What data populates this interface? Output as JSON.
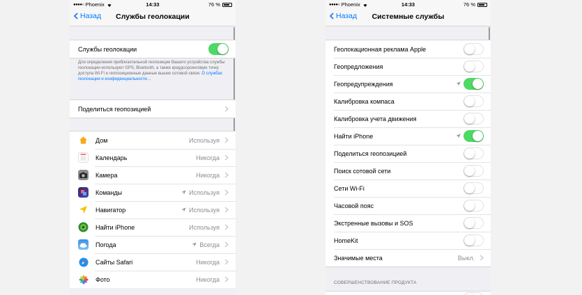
{
  "colors": {
    "accent": "#007aff",
    "toggle_on": "#4cd964",
    "secondary_text": "#8e8e93"
  },
  "left": {
    "status": {
      "carrier": "Phoenix",
      "time": "14:33",
      "battery": "76 %"
    },
    "nav": {
      "back": "Назад",
      "title": "Службы геолокации"
    },
    "main_toggle": {
      "label": "Службы геолокации",
      "on": true
    },
    "footer": {
      "text": "Для определения приблизительной геопозиции Вашего устройства службы геолокации используют GPS, Bluetooth, а также краудсорсинговую точку доступа Wi-Fi и геопозиционные данные вышек сотовой связи.",
      "link": "О службах геолокации и конфиденциальности…"
    },
    "share": {
      "label": "Поделиться геопозицией"
    },
    "apps": [
      {
        "name": "Дом",
        "value": "Используя",
        "arrow": false,
        "icon": "home-app-icon"
      },
      {
        "name": "Календарь",
        "value": "Никогда",
        "arrow": false,
        "icon": "calendar-app-icon"
      },
      {
        "name": "Камера",
        "value": "Никогда",
        "arrow": false,
        "icon": "camera-app-icon"
      },
      {
        "name": "Команды",
        "value": "Используя",
        "arrow": true,
        "icon": "shortcuts-app-icon"
      },
      {
        "name": "Навигатор",
        "value": "Используя",
        "arrow": true,
        "icon": "navigator-app-icon"
      },
      {
        "name": "Найти iPhone",
        "value": "Используя",
        "arrow": false,
        "icon": "find-iphone-app-icon"
      },
      {
        "name": "Погода",
        "value": "Всегда",
        "arrow": true,
        "icon": "weather-app-icon"
      },
      {
        "name": "Сайты Safari",
        "value": "Никогда",
        "arrow": false,
        "icon": "safari-app-icon"
      },
      {
        "name": "Фото",
        "value": "Никогда",
        "arrow": false,
        "icon": "photos-app-icon"
      }
    ]
  },
  "right": {
    "status": {
      "carrier": "Phoenix",
      "time": "14:33",
      "battery": "76 %"
    },
    "nav": {
      "back": "Назад",
      "title": "Системные службы"
    },
    "services": [
      {
        "label": "Геолокационная реклама Apple",
        "on": false,
        "arrow": false
      },
      {
        "label": "Геопредложения",
        "on": false,
        "arrow": false
      },
      {
        "label": "Геопредупреждения",
        "on": true,
        "arrow": true
      },
      {
        "label": "Калибровка компаса",
        "on": false,
        "arrow": false
      },
      {
        "label": "Калибровка учета движения",
        "on": false,
        "arrow": false
      },
      {
        "label": "Найти iPhone",
        "on": true,
        "arrow": true
      },
      {
        "label": "Поделиться геопозицией",
        "on": false,
        "arrow": false
      },
      {
        "label": "Поиск сотовой сети",
        "on": false,
        "arrow": false
      },
      {
        "label": "Сети Wi-Fi",
        "on": false,
        "arrow": false
      },
      {
        "label": "Часовой пояс",
        "on": false,
        "arrow": false
      },
      {
        "label": "Экстренные вызовы и SOS",
        "on": false,
        "arrow": false
      },
      {
        "label": "HomeKit",
        "on": false,
        "arrow": false
      }
    ],
    "significant": {
      "label": "Значимые места",
      "value": "Выкл."
    },
    "section_header": "СОВЕРШЕНСТВОВАНИЕ ПРОДУКТА"
  }
}
